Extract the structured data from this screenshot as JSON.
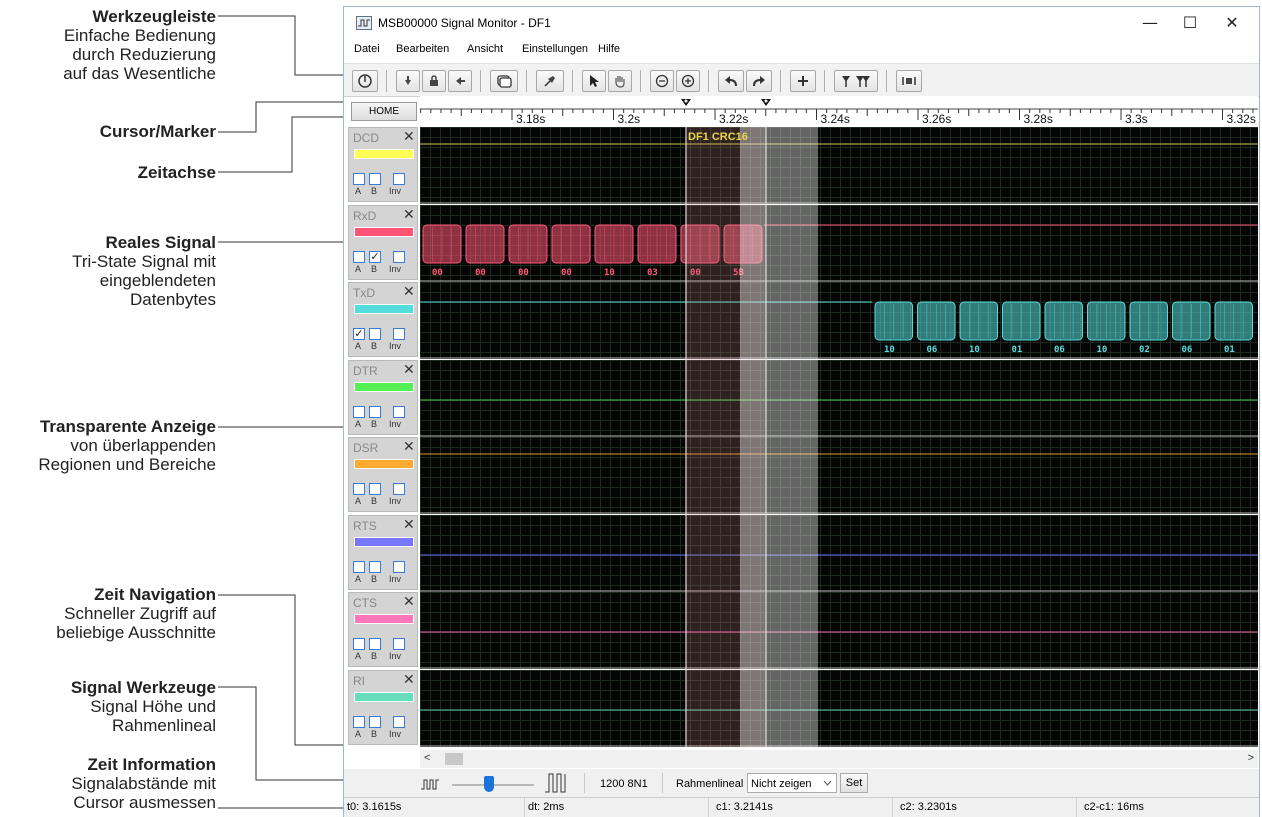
{
  "annotations": [
    {
      "title": "Werkzeugleiste",
      "lines": [
        "Einfache Bedienung",
        "durch Reduzierung",
        "auf das Wesentliche"
      ]
    },
    {
      "title": "Cursor/Marker",
      "lines": []
    },
    {
      "title": "Zeitachse",
      "lines": []
    },
    {
      "title": "Reales Signal",
      "lines": [
        "Tri-State Signal mit",
        "eingeblendeten",
        "Datenbytes"
      ]
    },
    {
      "title": "Transparente Anzeige",
      "lines": [
        "von überlappenden",
        "Regionen und Bereiche"
      ]
    },
    {
      "title": "Zeit Navigation",
      "lines": [
        "Schneller Zugriff auf",
        "beliebige Ausschnitte"
      ]
    },
    {
      "title": "Signal Werkzeuge",
      "lines": [
        "Signal Höhe und",
        "Rahmenlineal"
      ]
    },
    {
      "title": "Zeit Information",
      "lines": [
        "Signalabstände mit",
        "Cursor ausmessen"
      ]
    }
  ],
  "window": {
    "title": "MSB00000 Signal Monitor - DF1",
    "controls": {
      "minimize": "—",
      "maximize": "☐",
      "close": "✕"
    }
  },
  "menu": [
    "Datei",
    "Bearbeiten",
    "Ansicht",
    "Einstellungen",
    "Hilfe"
  ],
  "toolbar": {
    "icons": [
      "power-icon",
      "arrow-down-icon",
      "lock-icon",
      "arrow-left-icon",
      "window-icon",
      "pin-icon",
      "pointer-icon",
      "hand-icon",
      "zoom-out-icon",
      "zoom-in-icon",
      "undo-icon",
      "redo-icon",
      "plus-icon",
      "marker-icon",
      "double-marker-icon",
      "frame-icon"
    ]
  },
  "ruler": {
    "home_label": "HOME",
    "ticks": [
      "3.18s",
      "3.2s",
      "3.22s",
      "3.24s",
      "3.26s",
      "3.28s",
      "3.3s",
      "3.32s"
    ]
  },
  "region_label": "DF1 CRC16",
  "channels": [
    {
      "name": "DCD",
      "color": "#ffff55",
      "a": false,
      "b": false,
      "inv": false,
      "line": "#c8c850",
      "bytes": []
    },
    {
      "name": "RxD",
      "color": "#ff5577",
      "a": false,
      "b": true,
      "inv": false,
      "line": "#ff5577",
      "bytes": [
        "00",
        "00",
        "00",
        "00",
        "10",
        "03",
        "00",
        "5B"
      ]
    },
    {
      "name": "TxD",
      "color": "#55dddd",
      "a": true,
      "b": false,
      "inv": false,
      "line": "#55dddd",
      "bytes": [
        "10",
        "06",
        "10",
        "01",
        "06",
        "10",
        "02",
        "06",
        "01"
      ]
    },
    {
      "name": "DTR",
      "color": "#55ee55",
      "a": false,
      "b": false,
      "inv": false,
      "line": "#44cc44",
      "bytes": []
    },
    {
      "name": "DSR",
      "color": "#ffaa33",
      "a": false,
      "b": false,
      "inv": false,
      "line": "#dd9933",
      "bytes": []
    },
    {
      "name": "RTS",
      "color": "#7777ff",
      "a": false,
      "b": false,
      "inv": false,
      "line": "#6666ee",
      "bytes": []
    },
    {
      "name": "CTS",
      "color": "#ff77bb",
      "a": false,
      "b": false,
      "inv": false,
      "line": "#ee66aa",
      "bytes": []
    },
    {
      "name": "RI",
      "color": "#66ddbb",
      "a": false,
      "b": false,
      "inv": false,
      "line": "#55ccaa",
      "bytes": []
    }
  ],
  "checkbox_labels": {
    "a": "A",
    "b": "B",
    "inv": "Inv"
  },
  "close_glyph": "✕",
  "bottom": {
    "baud": "1200 8N1",
    "frame_ruler_label": "Rahmenlineal",
    "frame_ruler_value": "Nicht zeigen",
    "set_label": "Set",
    "scroll_left": "<",
    "scroll_right": ">",
    "height_slider": 0.45
  },
  "status": {
    "t0": "t0: 3.1615s",
    "dt": "dt: 2ms",
    "c1": "c1: 3.2141s",
    "c2": "c2: 3.2301s",
    "diff": "c2-c1: 16ms"
  }
}
